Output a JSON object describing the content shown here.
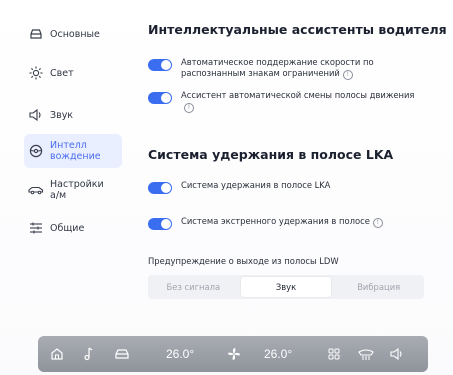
{
  "sidebar": {
    "items": [
      {
        "label": "Основные",
        "icon": "car-roof-icon"
      },
      {
        "label": "Свет",
        "icon": "sun-icon"
      },
      {
        "label": "Звук",
        "icon": "speaker-icon"
      },
      {
        "label": "Интелл\nвождение",
        "icon": "steering-wheel-icon",
        "active": true
      },
      {
        "label": "Настройки\nа/м",
        "icon": "car-icon"
      },
      {
        "label": "Общие",
        "icon": "sliders-icon"
      }
    ]
  },
  "main": {
    "section1_title": "Интеллектуальные ассистенты водителя",
    "section2_title": "Система удержания в полосе LKA",
    "rows": [
      {
        "text": "Автоматическое поддержание скорости по распознанным знакам ограничений",
        "on": true,
        "info": true
      },
      {
        "text": "Ассистент автоматической смены полосы движения",
        "on": true,
        "info": true
      },
      {
        "text": "Система удержания в полосе LKA",
        "on": true,
        "info": false
      },
      {
        "text": "Система экстренного удержания в полосе",
        "on": true,
        "info": true
      }
    ],
    "ldw_label": "Предупреждение о выходе из полосы LDW",
    "ldw_options": [
      "Без сигнала",
      "Звук",
      "Вибрация"
    ],
    "ldw_selected": "Звук",
    "info_glyph": "!"
  },
  "bottom_bar": {
    "temp_left": "26.0°",
    "temp_right": "26.0°"
  },
  "colors": {
    "accent": "#3a6df0",
    "active_bg": "#e9efff",
    "bar": "#9a9ea6"
  }
}
